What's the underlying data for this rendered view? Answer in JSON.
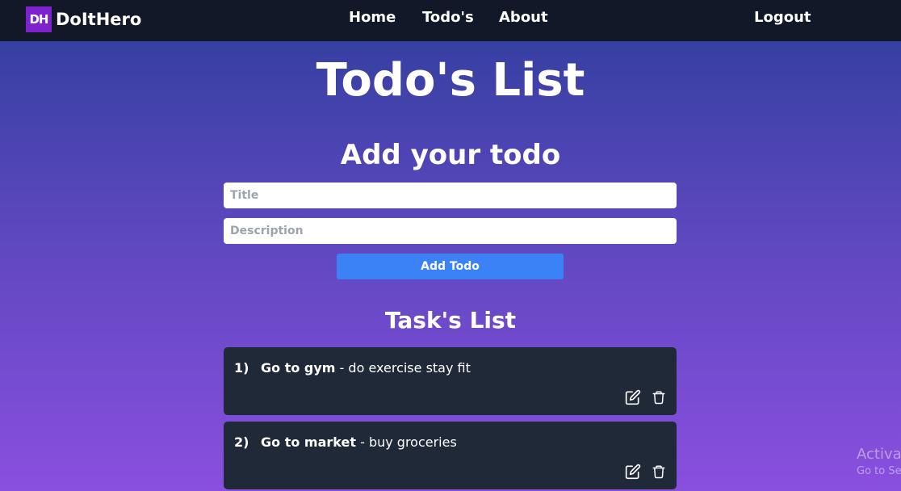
{
  "navbar": {
    "logo_text": "DH",
    "brand": "DoItHero",
    "links": [
      "Home",
      "Todo's",
      "About"
    ],
    "logout": "Logout"
  },
  "page_title": "Todo's List",
  "form": {
    "heading": "Add your todo",
    "title_placeholder": "Title",
    "title_value": "",
    "description_placeholder": "Description",
    "description_value": "",
    "submit_label": "Add Todo"
  },
  "tasks": {
    "heading": "Task's List",
    "items": [
      {
        "number": "1)",
        "title": "Go to gym",
        "separator": " - ",
        "description": "do exercise stay fit"
      },
      {
        "number": "2)",
        "title": "Go to market",
        "separator": " - ",
        "description": "buy groceries"
      }
    ]
  },
  "watermark": {
    "line1": "Activa",
    "line2": "Go to Se"
  },
  "colors": {
    "navbar": "#111827",
    "logo": "#7e22ce",
    "button": "#3b82f6",
    "card": "#1f2937",
    "gradient_top": "#2e3e9c",
    "gradient_bottom": "#8a4fdf"
  },
  "icons": [
    "edit-icon",
    "trash-icon"
  ]
}
